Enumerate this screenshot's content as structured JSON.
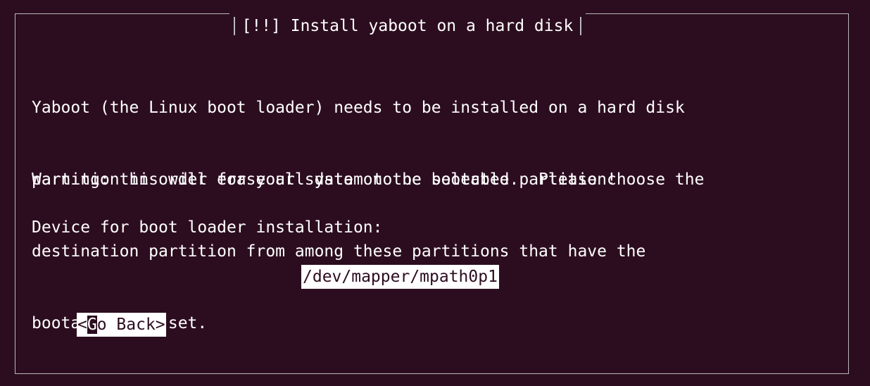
{
  "dialog": {
    "title": "[!!] Install yaboot on a hard disk",
    "body_lines": [
      "Yaboot (the Linux boot loader) needs to be installed on a hard disk",
      "partition in order for your system to be bootable.  Please choose the",
      "destination partition from among these partitions that have the",
      "bootable flag set."
    ],
    "warning": "Warning: this will erase all data on the selected partition!",
    "device_label": "Device for boot loader installation:",
    "device_options": [
      "/dev/mapper/mpath0p1"
    ],
    "go_back": {
      "prefix": "<",
      "highlight": "G",
      "rest": "o Back>"
    }
  },
  "colors": {
    "background": "#2c0d1f",
    "text": "#ffffff",
    "frame": "#b9b9b9",
    "selection_bg": "#ffffff",
    "selection_fg": "#2c0d1f"
  }
}
